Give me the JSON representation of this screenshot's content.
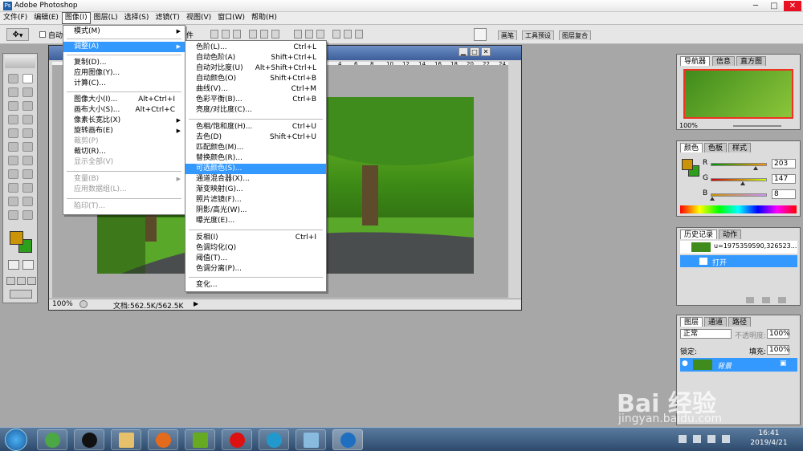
{
  "window": {
    "title": "Adobe Photoshop",
    "app_icon": "Ps",
    "minimize": "─",
    "maximize": "□",
    "close": "✕"
  },
  "menubar": [
    "文件(F)",
    "编辑(E)",
    "图像(I)",
    "图层(L)",
    "选择(S)",
    "滤镜(T)",
    "视图(V)",
    "窗口(W)",
    "帮助(H)"
  ],
  "optbar": {
    "auto_label": "自动",
    "part_label": "件"
  },
  "dock_tabs": [
    "画笔",
    "工具预设",
    "图层复合"
  ],
  "image_menu": [
    {
      "label": "模式(M)",
      "sub": "▶"
    },
    {
      "label": "调整(A)",
      "sub": "▶",
      "highlight": true
    },
    {
      "label": "复制(D)..."
    },
    {
      "label": "应用图像(Y)..."
    },
    {
      "label": "计算(C)..."
    },
    {
      "label": "图像大小(I)...",
      "shortcut": "Alt+Ctrl+I"
    },
    {
      "label": "画布大小(S)...",
      "shortcut": "Alt+Ctrl+C"
    },
    {
      "label": "像素长宽比(X)",
      "sub": "▶"
    },
    {
      "label": "旋转画布(E)",
      "sub": "▶"
    },
    {
      "label": "裁剪(P)",
      "disabled": true
    },
    {
      "label": "裁切(R)..."
    },
    {
      "label": "显示全部(V)",
      "disabled": true
    },
    {
      "label": "变量(B)",
      "sub": "▶",
      "disabled": true
    },
    {
      "label": "应用数据组(L)...",
      "disabled": true
    },
    {
      "label": "陷印(T)...",
      "disabled": true
    }
  ],
  "adjust_menu": [
    {
      "label": "色阶(L)...",
      "shortcut": "Ctrl+L"
    },
    {
      "label": "自动色阶(A)",
      "shortcut": "Shift+Ctrl+L"
    },
    {
      "label": "自动对比度(U)",
      "shortcut": "Alt+Shift+Ctrl+L"
    },
    {
      "label": "自动颜色(O)",
      "shortcut": "Shift+Ctrl+B"
    },
    {
      "label": "曲线(V)...",
      "shortcut": "Ctrl+M"
    },
    {
      "label": "色彩平衡(B)...",
      "shortcut": "Ctrl+B"
    },
    {
      "label": "亮度/对比度(C)..."
    },
    {
      "label": "色相/饱和度(H)...",
      "shortcut": "Ctrl+U"
    },
    {
      "label": "去色(D)",
      "shortcut": "Shift+Ctrl+U"
    },
    {
      "label": "匹配颜色(M)..."
    },
    {
      "label": "替换颜色(R)..."
    },
    {
      "label": "可选颜色(S)...",
      "highlight": true
    },
    {
      "label": "通道混合器(X)..."
    },
    {
      "label": "渐变映射(G)..."
    },
    {
      "label": "照片滤镜(F)..."
    },
    {
      "label": "阴影/高光(W)..."
    },
    {
      "label": "曝光度(E)..."
    },
    {
      "label": "反相(I)",
      "shortcut": "Ctrl+I"
    },
    {
      "label": "色调均化(Q)"
    },
    {
      "label": "阈值(T)..."
    },
    {
      "label": "色调分离(P)..."
    },
    {
      "label": "变化..."
    }
  ],
  "document": {
    "zoom": "100%",
    "status": "文档:562.5K/562.5K",
    "ruler_marks": [
      "4",
      "6",
      "8",
      "10",
      "12",
      "14",
      "16",
      "18",
      "20",
      "22",
      "24"
    ]
  },
  "navigator": {
    "tabs": [
      "导航器",
      "信息",
      "直方图"
    ],
    "zoom": "100%"
  },
  "color_panel": {
    "tabs": [
      "颜色",
      "色板",
      "样式"
    ],
    "channels": [
      {
        "label": "R",
        "value": "203",
        "level": 0.796
      },
      {
        "label": "G",
        "value": "147",
        "level": 0.576
      },
      {
        "label": "B",
        "value": "8",
        "level": 0.031
      }
    ],
    "fg_color": "#cb9308",
    "bg_color": "#2e9e1d"
  },
  "history_panel": {
    "tabs": [
      "历史记录",
      "动作"
    ],
    "snapshot": "u=1975359590,326523...",
    "items": [
      "打开"
    ]
  },
  "layers_panel": {
    "tabs": [
      "图层",
      "通道",
      "路径"
    ],
    "blend_mode": "正常",
    "opacity_label": "不透明度:",
    "opacity": "100%",
    "lock_label": "锁定:",
    "fill_label": "填充:",
    "fill": "100%",
    "layer_name": "背景"
  },
  "taskbar": {
    "time": "16:41",
    "date": "2019/4/21"
  },
  "watermark": {
    "text": "Bai 经验",
    "url": "jingyan.baidu.com"
  }
}
